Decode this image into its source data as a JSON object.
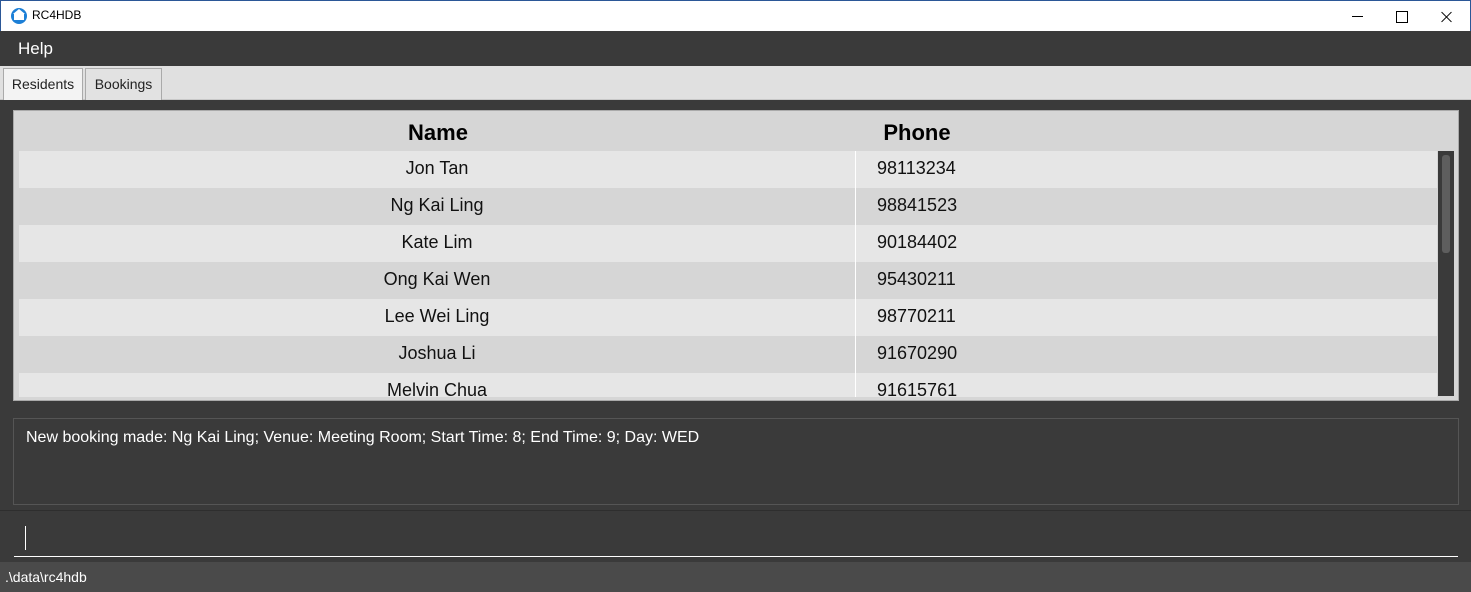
{
  "window": {
    "title": "RC4HDB",
    "icon": "house-icon"
  },
  "menu": {
    "help_label": "Help"
  },
  "tabs": [
    {
      "label": "Residents",
      "selected": true
    },
    {
      "label": "Bookings",
      "selected": false
    }
  ],
  "table": {
    "headers": {
      "name": "Name",
      "phone": "Phone"
    },
    "rows": [
      {
        "name": "Jon Tan",
        "phone": "98113234"
      },
      {
        "name": "Ng Kai Ling",
        "phone": "98841523"
      },
      {
        "name": "Kate Lim",
        "phone": "90184402"
      },
      {
        "name": "Ong Kai Wen",
        "phone": "95430211"
      },
      {
        "name": "Lee Wei Ling",
        "phone": "98770211"
      },
      {
        "name": "Joshua Li",
        "phone": "91670290"
      },
      {
        "name": "Melvin Chua",
        "phone": "91615761"
      }
    ]
  },
  "result": {
    "text": "New booking made: Ng Kai Ling; Venue: Meeting Room; Start Time: 8; End Time: 9; Day: WED"
  },
  "command": {
    "value": ""
  },
  "status": {
    "path": ".\\data\\rc4hdb"
  },
  "colors": {
    "background": "#3a3a3a",
    "row_light": "#e6e6e6",
    "row_dark": "#d6d6d6",
    "titlebar_border": "#2b5797",
    "icon_blue": "#1c7fd6"
  }
}
